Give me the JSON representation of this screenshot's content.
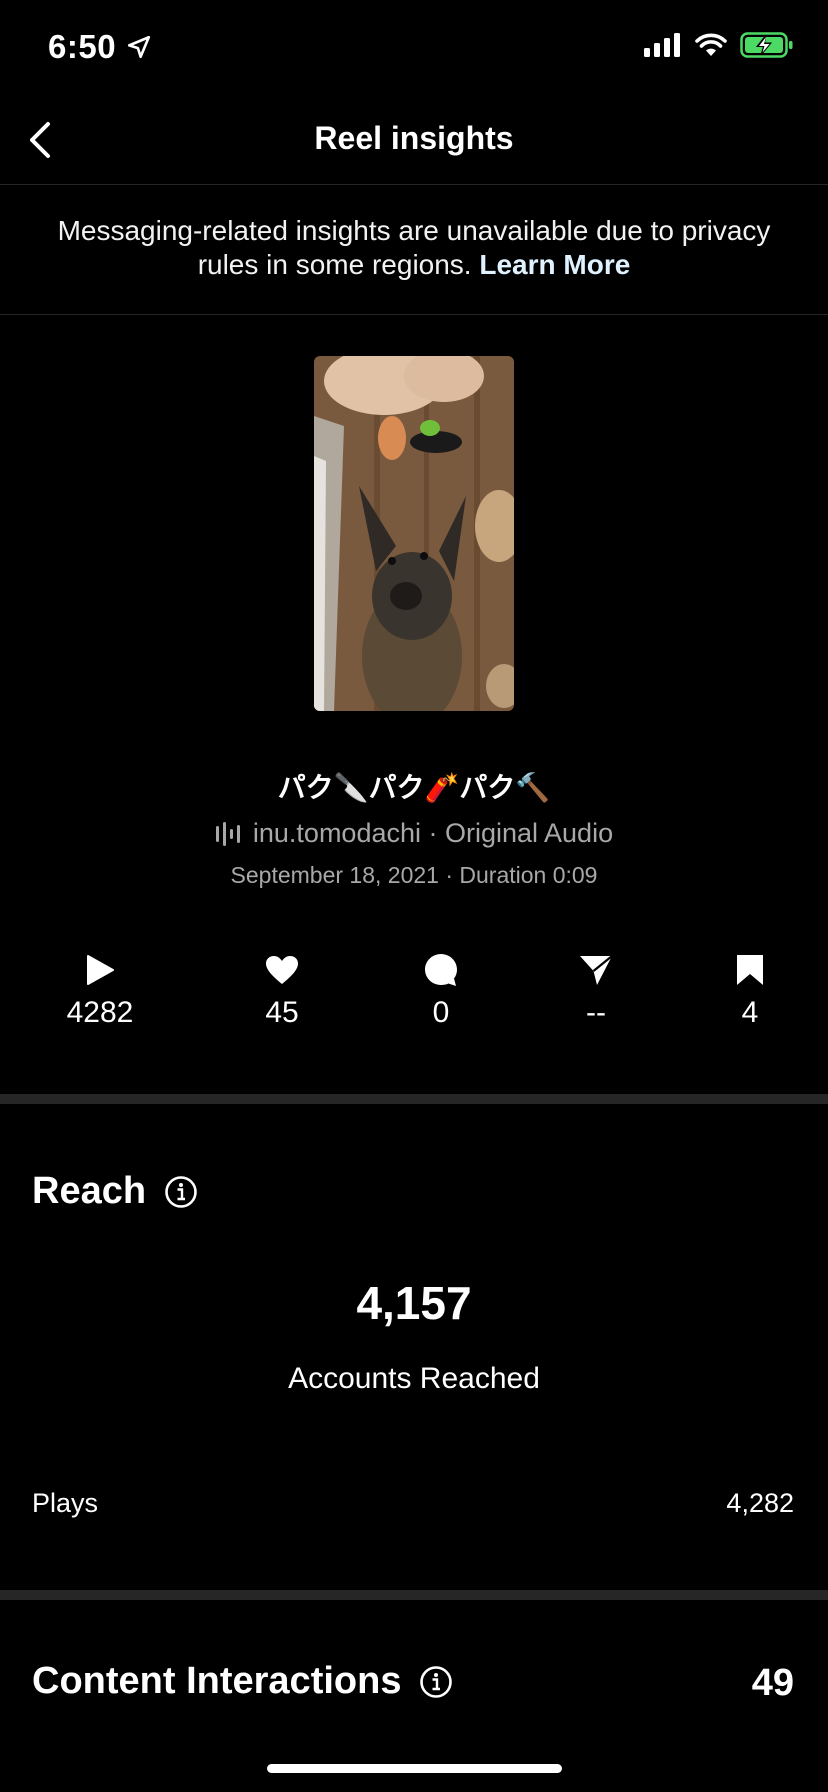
{
  "status": {
    "time": "6:50"
  },
  "nav": {
    "title": "Reel insights"
  },
  "notice": {
    "text": "Messaging-related insights are unavailable due to privacy rules in some regions.",
    "link": "Learn More"
  },
  "reel": {
    "title": "パク🔪パク🧨パク🔨",
    "audio": "inu.tomodachi · Original Audio",
    "date": "September 18, 2021 · Duration 0:09"
  },
  "metrics": {
    "plays": "4282",
    "likes": "45",
    "comments": "0",
    "shares": "--",
    "saves": "4"
  },
  "reach": {
    "title": "Reach",
    "accounts_reached_value": "4,157",
    "accounts_reached_label": "Accounts Reached",
    "plays_label": "Plays",
    "plays_value": "4,282"
  },
  "content_interactions": {
    "title": "Content Interactions",
    "value": "49"
  },
  "colors": {
    "background": "#000000",
    "divider": "#262626",
    "secondary_text": "#a8a8a8",
    "battery": "#4cd964"
  }
}
